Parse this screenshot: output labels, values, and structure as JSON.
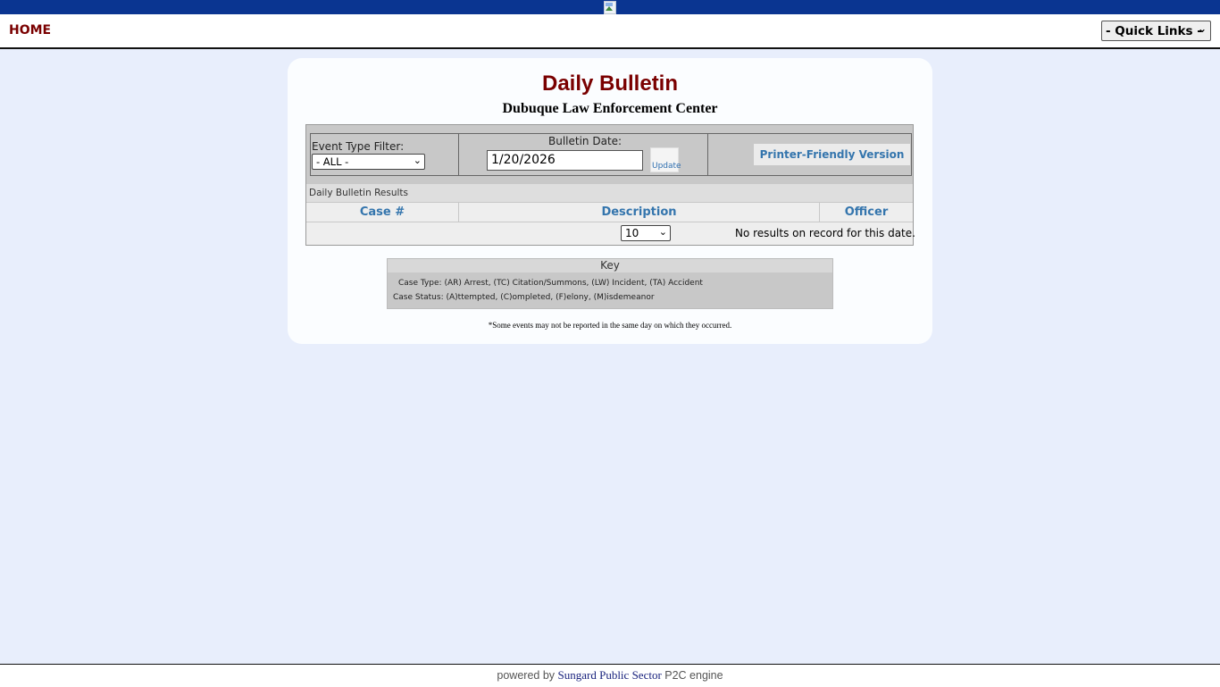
{
  "header": {
    "logo_alt": "",
    "home_label": "HOME",
    "quick_links_selected": "- Quick Links -"
  },
  "bulletin": {
    "title": "Daily Bulletin",
    "subtitle": "Dubuque Law Enforcement Center",
    "filter": {
      "event_type_label": "Event Type Filter:",
      "event_type_selected": "- ALL -",
      "date_label": "Bulletin Date:",
      "date_value": "1/20/2026",
      "update_label": "Update",
      "printer_friendly_label": "Printer-Friendly Version"
    },
    "results": {
      "header": "Daily Bulletin Results",
      "columns": [
        "Case #",
        "Description",
        "Officer"
      ],
      "page_size": "10",
      "empty_message": "No results on record for this date."
    },
    "key": {
      "title": "Key",
      "case_type_label": "Case Type:",
      "case_type_text": "(AR) Arrest, (TC) Citation/Summons, (LW) Incident, (TA) Accident",
      "case_status_label": "Case Status:",
      "case_status_text": "(A)ttempted, (C)ompleted, (F)elony, (M)isdemeanor"
    },
    "footnote": "*Some events may not be reported in the same day on which they occurred."
  },
  "footer": {
    "prefix": "powered by ",
    "link": "Sungard Public Sector",
    "suffix": " P2C engine"
  },
  "colors": {
    "topbar": "#0a3591",
    "page_bg": "#e8eefc",
    "title": "#7a0000",
    "link_blue": "#3475ad"
  }
}
